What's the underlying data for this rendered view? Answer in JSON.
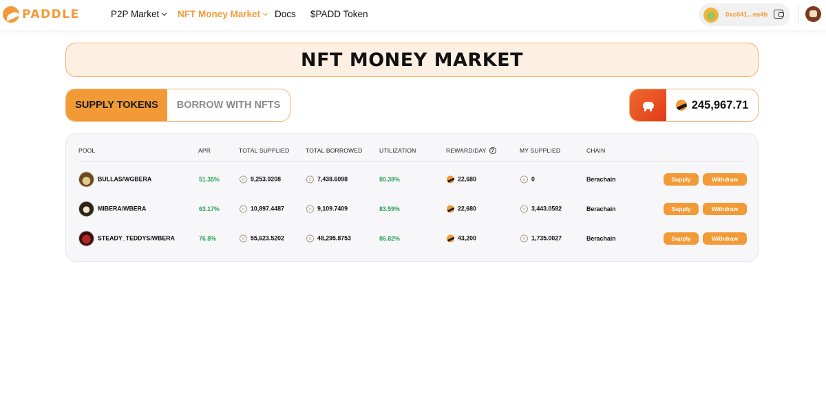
{
  "brand": {
    "name": "PADDLE",
    "accent": "#f29a36"
  },
  "nav": [
    {
      "label": "P2P Market",
      "has_dropdown": true,
      "active": false
    },
    {
      "label": "NFT Money Market",
      "has_dropdown": true,
      "active": true
    },
    {
      "label": "Docs",
      "has_dropdown": false,
      "active": false
    },
    {
      "label": "$PADD Token",
      "has_dropdown": false,
      "active": false
    }
  ],
  "wallet": {
    "address": "0xc841...ea4b"
  },
  "page": {
    "title": "NFT MONEY MARKET"
  },
  "tabs": {
    "supply": "SUPPLY TOKENS",
    "borrow": "BORROW WITH NFTS",
    "selected": "supply"
  },
  "balance": {
    "value": "245,967.71"
  },
  "table": {
    "headers": {
      "pool": "POOL",
      "apr": "APR",
      "total_supplied": "TOTAL SUPPLIED",
      "total_borrowed": "TOTAL BORROWED",
      "utilization": "UTILIZATION",
      "reward_day": "REWARD/DAY",
      "my_supplied": "MY SUPPLIED",
      "chain": "CHAIN"
    },
    "rows": [
      {
        "pool": "BULLAS/WGBERA",
        "apr": "51.35%",
        "total_supplied": "9,253.9208",
        "total_borrowed": "7,438.6098",
        "utilization": "80.38%",
        "reward_day": "22,680",
        "my_supplied": "0",
        "chain": "Berachain"
      },
      {
        "pool": "MIBERA/WBERA",
        "apr": "63.17%",
        "total_supplied": "10,897.4487",
        "total_borrowed": "9,109.7409",
        "utilization": "83.59%",
        "reward_day": "22,680",
        "my_supplied": "3,443.0582",
        "chain": "Berachain"
      },
      {
        "pool": "STEADY_TEDDYS/WBERA",
        "apr": "76.8%",
        "total_supplied": "55,623.5202",
        "total_borrowed": "48,295.8753",
        "utilization": "86.82%",
        "reward_day": "43,200",
        "my_supplied": "1,735.0027",
        "chain": "Berachain"
      }
    ],
    "actions": {
      "supply": "Supply",
      "withdraw": "Withdraw"
    }
  },
  "colors": {
    "accent": "#f29a36",
    "positive": "#2aa05a",
    "banner_bg": "#fdf0e3"
  }
}
